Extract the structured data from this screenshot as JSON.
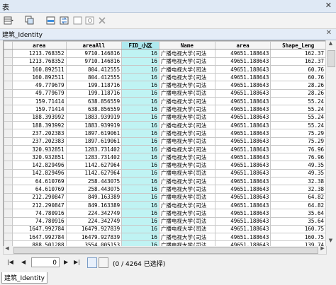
{
  "window": {
    "title": "表",
    "close_glyph": "✕"
  },
  "toolbar": {
    "icons": [
      "table-options-icon",
      "related-tables-icon",
      "select-by-attributes-icon",
      "switch-selection-icon",
      "clear-selection-icon",
      "zoom-to-selected-icon",
      "delete-selected-icon"
    ]
  },
  "tab": {
    "label": "建筑_Identity",
    "close_glyph": "✕"
  },
  "columns": [
    "area",
    "areaAll",
    "FID_小区",
    "Name",
    "area",
    "Shape_Leng"
  ],
  "rows": [
    [
      "1213.768352",
      "9710.146816",
      "16",
      "广播电视大学(司法",
      "49651.188643",
      "162.37"
    ],
    [
      "1213.768352",
      "9710.146816",
      "16",
      "广播电视大学(司法",
      "49651.188643",
      "162.37"
    ],
    [
      "160.892511",
      "804.412555",
      "16",
      "广播电视大学(司法",
      "49651.188643",
      "60.76"
    ],
    [
      "160.892511",
      "804.412555",
      "16",
      "广播电视大学(司法",
      "49651.188643",
      "60.76"
    ],
    [
      "49.779679",
      "199.118716",
      "16",
      "广播电视大学(司法",
      "49651.188643",
      "28.26"
    ],
    [
      "49.779679",
      "199.118716",
      "16",
      "广播电视大学(司法",
      "49651.188643",
      "28.26"
    ],
    [
      "159.71414",
      "638.856559",
      "16",
      "广播电视大学(司法",
      "49651.188643",
      "55.24"
    ],
    [
      "159.71414",
      "638.856559",
      "16",
      "广播电视大学(司法",
      "49651.188643",
      "55.24"
    ],
    [
      "188.393992",
      "1883.939919",
      "16",
      "广播电视大学(司法",
      "49651.188643",
      "55.24"
    ],
    [
      "188.393992",
      "1883.939919",
      "16",
      "广播电视大学(司法",
      "49651.188643",
      "55.24"
    ],
    [
      "237.202383",
      "1897.619061",
      "16",
      "广播电视大学(司法",
      "49651.188643",
      "75.29"
    ],
    [
      "237.202383",
      "1897.619061",
      "16",
      "广播电视大学(司法",
      "49651.188643",
      "75.29"
    ],
    [
      "320.932851",
      "1283.731402",
      "16",
      "广播电视大学(司法",
      "49651.188643",
      "76.96"
    ],
    [
      "320.932851",
      "1283.731402",
      "16",
      "广播电视大学(司法",
      "49651.188643",
      "76.96"
    ],
    [
      "142.829496",
      "1142.627964",
      "16",
      "广播电视大学(司法",
      "49651.188643",
      "49.35"
    ],
    [
      "142.829496",
      "1142.627964",
      "16",
      "广播电视大学(司法",
      "49651.188643",
      "49.35"
    ],
    [
      "64.610769",
      "258.443075",
      "16",
      "广播电视大学(司法",
      "49651.188643",
      "32.38"
    ],
    [
      "64.610769",
      "258.443075",
      "16",
      "广播电视大学(司法",
      "49651.188643",
      "32.38"
    ],
    [
      "212.290847",
      "849.163389",
      "16",
      "广播电视大学(司法",
      "49651.188643",
      "64.82"
    ],
    [
      "212.290847",
      "849.163389",
      "16",
      "广播电视大学(司法",
      "49651.188643",
      "64.82"
    ],
    [
      "74.780916",
      "224.342749",
      "16",
      "广播电视大学(司法",
      "49651.188643",
      "35.64"
    ],
    [
      "74.780916",
      "224.342749",
      "16",
      "广播电视大学(司法",
      "49651.188643",
      "35.64"
    ],
    [
      "1647.992784",
      "16479.927839",
      "16",
      "广播电视大学(司法",
      "49651.188643",
      "160.75"
    ],
    [
      "1647.992784",
      "16479.927839",
      "16",
      "广播电视大学(司法",
      "49651.188643",
      "160.75"
    ],
    [
      "888.501288",
      "3554.005153",
      "16",
      "广播电视大学(司法",
      "49651.188643",
      "139.74"
    ]
  ],
  "nav": {
    "record": "0",
    "count_text": "(0 / 4264 已选择)"
  },
  "bottom_tab": {
    "label": "建筑_Identity"
  }
}
